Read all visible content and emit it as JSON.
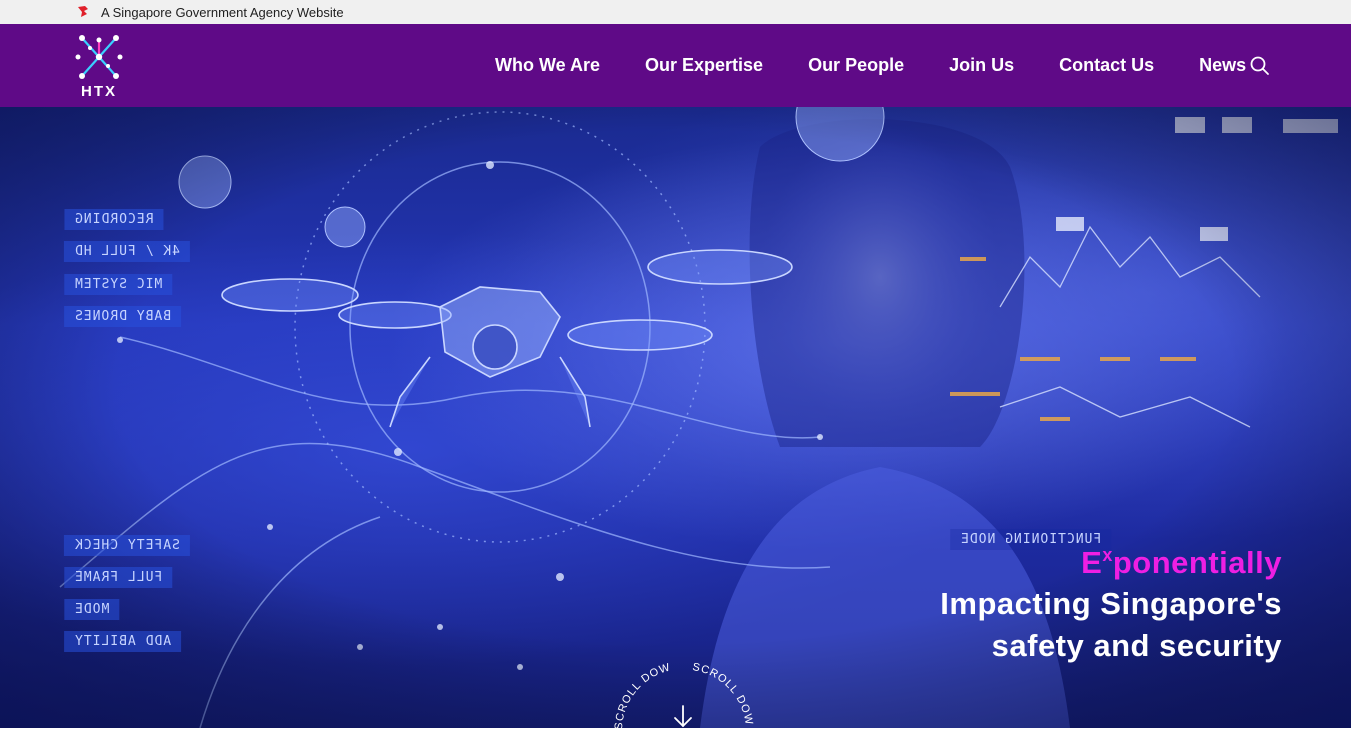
{
  "gov_bar": {
    "text": "A Singapore Government Agency Website"
  },
  "nav": {
    "logo_text": "HTX",
    "links": [
      {
        "label": "Who We Are"
      },
      {
        "label": "Our Expertise"
      },
      {
        "label": "Our People"
      },
      {
        "label": "Join Us"
      },
      {
        "label": "Contact Us"
      },
      {
        "label": "News"
      }
    ],
    "search_icon": "search-icon"
  },
  "hero": {
    "overlay_labels_left": [
      "RECORDING",
      "4K / FULL HD",
      "MIC SYSTEM",
      "BABY DRONES"
    ],
    "overlay_labels_bottom": [
      "SAFETY CHECK",
      "FULL FRAME",
      "MODE",
      "ADD ABILITY"
    ],
    "overlay_label_right": "FUNCTIONING NODE",
    "headline_accent_first": "E",
    "headline_accent_sup": "x",
    "headline_accent_rest": "ponentially",
    "headline_line1": "Impacting Singapore's",
    "headline_line2": "safety and security",
    "scroll_label": "SCROLL DOWN"
  },
  "colors": {
    "nav_bg": "#5f0a87",
    "accent_magenta": "#ee1fe3",
    "gov_bar_bg": "#f0f0f0"
  }
}
